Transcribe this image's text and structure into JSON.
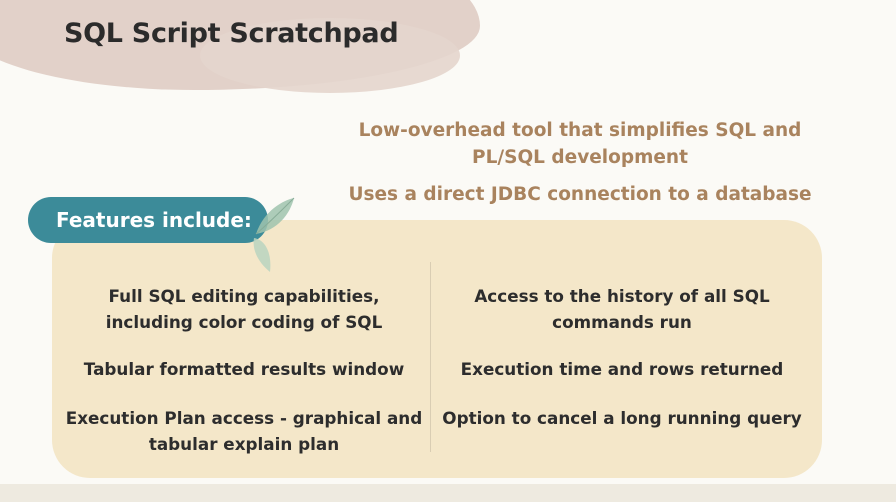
{
  "title": "SQL Script Scratchpad",
  "subtitle_1": "Low-overhead tool that simplifies SQL and PL/SQL development",
  "subtitle_2": "Uses a direct JDBC connection to a database",
  "features_label": "Features include:",
  "features_left": [
    "Full SQL editing capabilities, including color coding of SQL",
    "Tabular formatted results window",
    "Execution Plan access - graphical and tabular explain plan"
  ],
  "features_right": [
    "Access to the history of all SQL commands run",
    "Execution time and rows returned",
    "Option to cancel a long running query"
  ],
  "colors": {
    "accent_teal": "#3c8b99",
    "subtitle_brown": "#a9835e",
    "panel_beige": "#f4e7c9",
    "title_blob": "#e0cfc6"
  }
}
